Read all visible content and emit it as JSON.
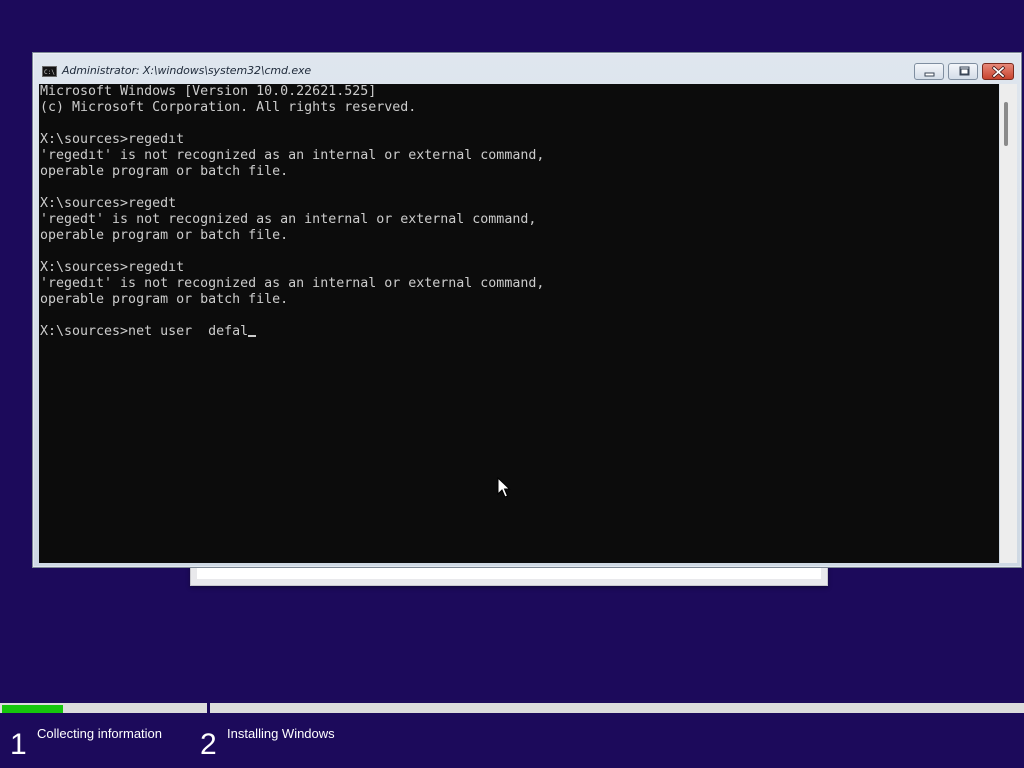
{
  "window": {
    "title": "Administrator: X:\\windows\\system32\\cmd.exe"
  },
  "console": {
    "lines": [
      "Microsoft Windows [Version 10.0.22621.525]",
      "(c) Microsoft Corporation. All rights reserved.",
      "",
      "X:\\sources>regedıt",
      "'regedıt' is not recognized as an internal or external command,",
      "operable program or batch file.",
      "",
      "X:\\sources>regedt",
      "'regedt' is not recognized as an internal or external command,",
      "operable program or batch file.",
      "",
      "X:\\sources>regedıt",
      "'regedıt' is not recognized as an internal or external command,",
      "operable program or batch file.",
      "",
      "X:\\sources>net user  defal"
    ]
  },
  "setup_progress": {
    "fraction": 0.06,
    "steps": [
      {
        "number": "1",
        "label": "Collecting information"
      },
      {
        "number": "2",
        "label": "Installing Windows"
      }
    ]
  },
  "icons": {
    "window_icon": "cmd-icon",
    "minimize": "minimize-icon",
    "maximize": "restore-icon",
    "close": "close-icon",
    "pointer": "mouse-pointer-icon"
  },
  "colors": {
    "background": "#1c0a5b",
    "console_bg": "#0c0c0c",
    "console_fg": "#cccccc",
    "progress": "#16c60c"
  }
}
